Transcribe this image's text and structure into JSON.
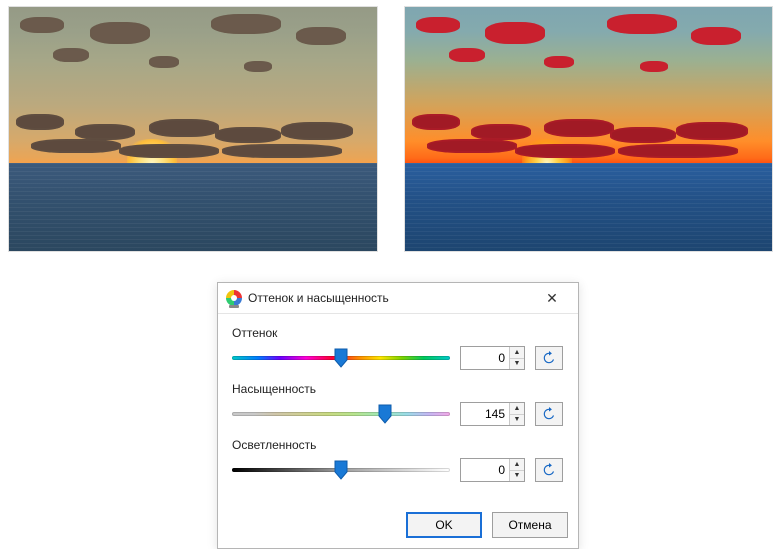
{
  "dialog": {
    "title": "Оттенок и насыщенность",
    "close_icon": "✕",
    "hue": {
      "label": "Оттенок",
      "value": "0",
      "min": -180,
      "max": 180,
      "thumb_pct": 50
    },
    "saturation": {
      "label": "Насыщенность",
      "value": "145",
      "min": -100,
      "max": 200,
      "thumb_pct": 70
    },
    "lightness": {
      "label": "Осветленность",
      "value": "0",
      "min": -100,
      "max": 100,
      "thumb_pct": 50
    },
    "ok_label": "OK",
    "cancel_label": "Отмена"
  }
}
